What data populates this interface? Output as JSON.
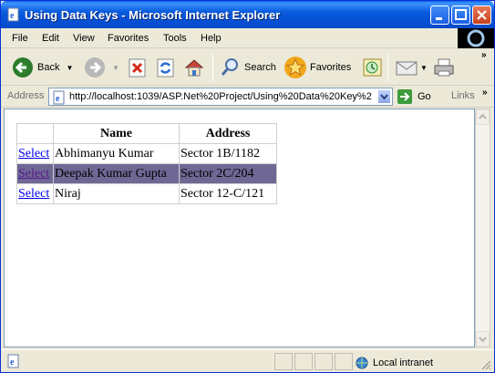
{
  "window": {
    "title": "Using Data Keys - Microsoft Internet Explorer"
  },
  "menu": [
    "File",
    "Edit",
    "View",
    "Favorites",
    "Tools",
    "Help"
  ],
  "toolbar": {
    "back": "Back",
    "search": "Search",
    "favorites": "Favorites"
  },
  "address": {
    "label": "Address",
    "url": "http://localhost:1039/ASP.Net%20Project/Using%20Data%20Key%2",
    "go": "Go",
    "links": "Links"
  },
  "grid": {
    "headers": [
      "",
      "Name",
      "Address"
    ],
    "select_label": "Select",
    "rows": [
      {
        "name": "Abhimanyu Kumar",
        "address": "Sector 1B/1182",
        "selected": false
      },
      {
        "name": "Deepak Kumar Gupta",
        "address": "Sector 2C/204",
        "selected": true
      },
      {
        "name": "Niraj",
        "address": "Sector 12-C/121",
        "selected": false
      }
    ]
  },
  "status": {
    "zone": "Local intranet"
  },
  "colors": {
    "titlebar": "#0a5bdc",
    "selected_row": "#6f6895",
    "link": "#0000ee"
  }
}
